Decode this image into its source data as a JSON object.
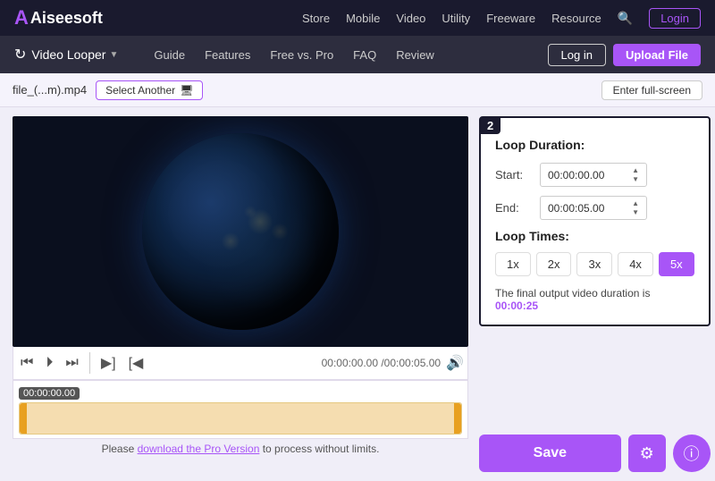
{
  "topNav": {
    "logo": "Aiseesoft",
    "links": [
      "Store",
      "Mobile",
      "Video",
      "Utility",
      "Freeware",
      "Resource"
    ],
    "loginLabel": "Login"
  },
  "secondNav": {
    "toolName": "Video Looper",
    "links": [
      "Guide",
      "Features",
      "Free vs. Pro",
      "FAQ",
      "Review"
    ],
    "logInLabel": "Log in",
    "uploadLabel": "Upload File"
  },
  "fileBar": {
    "fileName": "file_(...m).mp4",
    "selectAnotherLabel": "Select Another",
    "fullscreenLabel": "Enter full-screen"
  },
  "videoControls": {
    "timeDisplay": "00:00:00.00 /00:00:05.00"
  },
  "timeline": {
    "timeLabel": "00:00:00.00",
    "proMessage": "Please ",
    "proLinkText": "download the Pro Version",
    "proMessageEnd": " to process without limits."
  },
  "loopSettings": {
    "stepBadge": "2",
    "loopDurationTitle": "Loop Duration:",
    "startLabel": "Start:",
    "startValue": "00:00:00.00",
    "endLabel": "End:",
    "endValue": "00:00:05.00",
    "loopTimesTitle": "Loop Times:",
    "loopButtons": [
      "1x",
      "2x",
      "3x",
      "4x",
      "5x"
    ],
    "activeLoop": "5x",
    "outputText": "The final output video duration is ",
    "outputDuration": "00:00:25"
  },
  "saveArea": {
    "saveLabel": "Save"
  }
}
